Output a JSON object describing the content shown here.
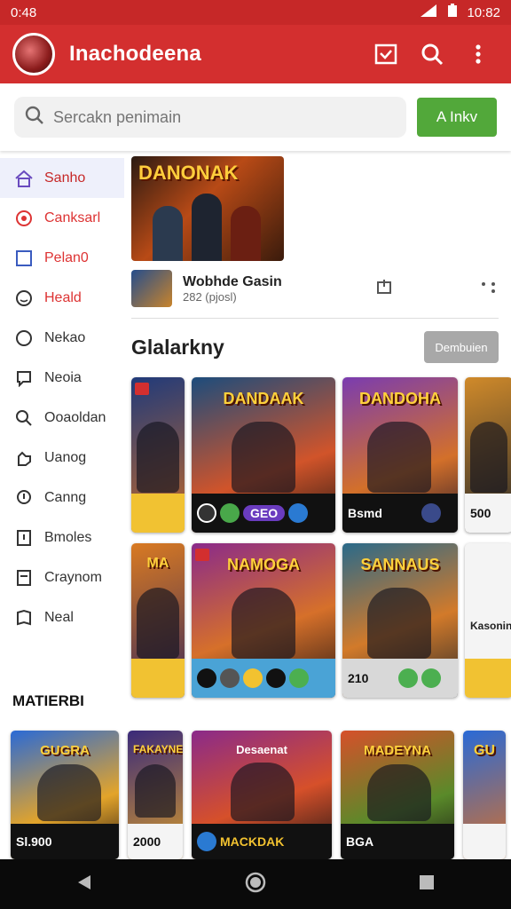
{
  "status": {
    "time": "0:48",
    "right_time": "10:82"
  },
  "app": {
    "title": "Inachodeena"
  },
  "search": {
    "placeholder": "Sercakn penimain",
    "button": "A Inkv"
  },
  "sidebar": {
    "items": [
      {
        "label": "Sanho",
        "icon": "home-icon",
        "active": true
      },
      {
        "label": "Canksarl",
        "icon": "circle-icon"
      },
      {
        "label": "Pelan0",
        "icon": "box-icon"
      },
      {
        "label": "Heald",
        "icon": "smile-icon"
      },
      {
        "label": "Nekao",
        "icon": "circle-outline-icon"
      },
      {
        "label": "Neoia",
        "icon": "chat-icon"
      },
      {
        "label": "Ooaoldan",
        "icon": "search-person-icon"
      },
      {
        "label": "Uanog",
        "icon": "hand-icon"
      },
      {
        "label": "Canng",
        "icon": "pin-icon"
      },
      {
        "label": "Bmoles",
        "icon": "exclaim-icon"
      },
      {
        "label": "Craynom",
        "icon": "doc-icon"
      },
      {
        "label": "Neal",
        "icon": "book-icon"
      }
    ]
  },
  "feature": {
    "banner": "DANONAK",
    "title": "Wobhde Gasin",
    "sub": "282 (pjosl)"
  },
  "section": {
    "title": "Glalarkny",
    "button": "Dembuien"
  },
  "row1": [
    {
      "title": "",
      "bottom": ""
    },
    {
      "title": "DANDAAK",
      "bottom": "GEO"
    },
    {
      "title": "DANDOHA",
      "bottom": "Bsmd"
    },
    {
      "title": "",
      "bottom": "500"
    }
  ],
  "row2": [
    {
      "title": "MA",
      "bottom": ""
    },
    {
      "title": "NAMOGA",
      "bottom": ""
    },
    {
      "title": "SANNAUS",
      "bottom": "210"
    },
    {
      "title": "Kasonin",
      "bottom": ""
    }
  ],
  "materi": "MATIERBI",
  "row3": [
    {
      "title": "GUGRA",
      "bottom": "Sl.900"
    },
    {
      "title": "FAKAYNE",
      "bottom": "2000"
    },
    {
      "title": "Desaenat",
      "bottom": "MACKDAK"
    },
    {
      "title": "MADEYNA",
      "bottom": "BGA"
    },
    {
      "title": "GU",
      "bottom": ""
    }
  ],
  "colors": {
    "primary": "#d32f2f",
    "green": "#52a83a"
  }
}
